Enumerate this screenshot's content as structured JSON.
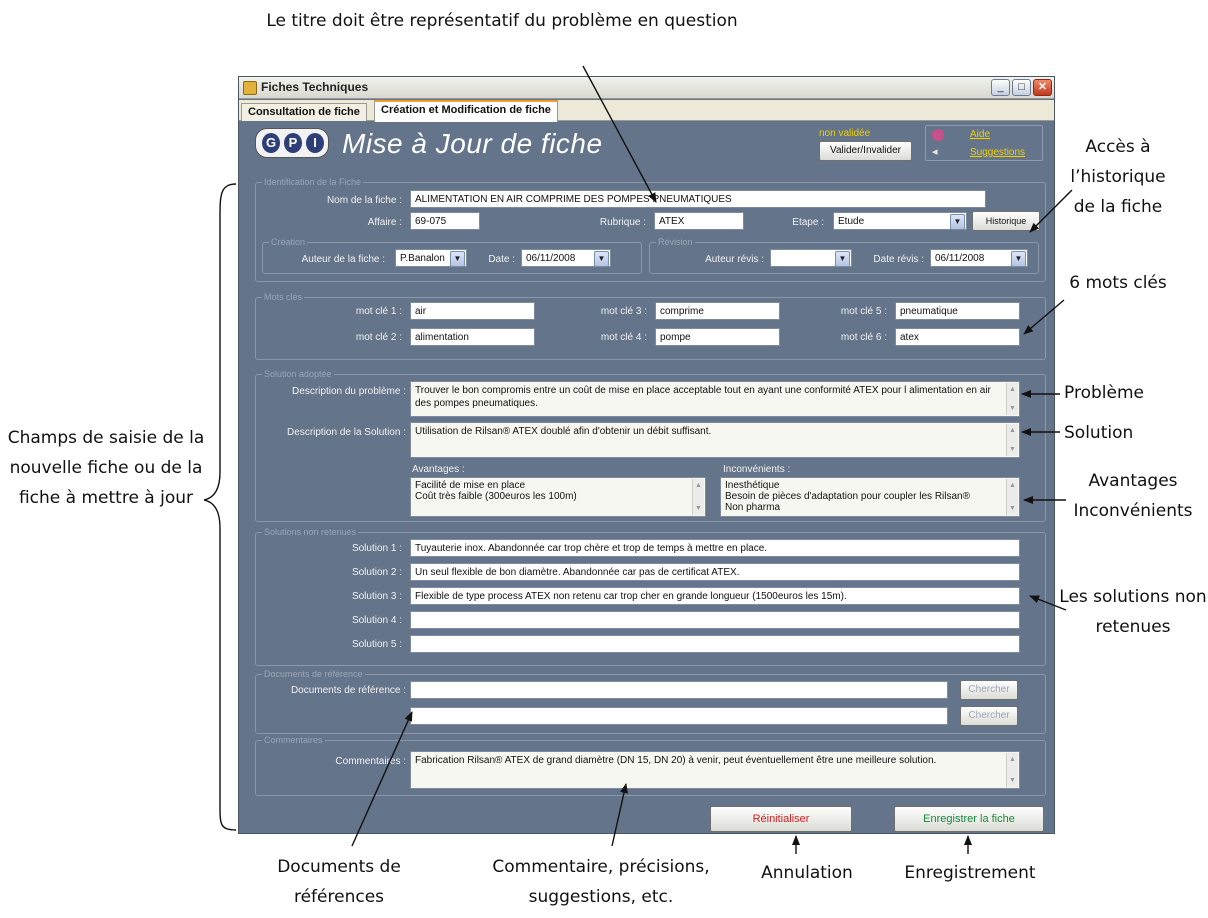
{
  "annotations": {
    "top_title": "Le titre doit être représentatif du problème en question",
    "history": "Accès à l’historique de la fiche",
    "keywords": "6 mots clés",
    "problem": "Problème",
    "solution": "Solution",
    "advantages": "Avantages Inconvénients",
    "rejected": "Les solutions non retenues",
    "left_fields": "Champs de saisie de la nouvelle fiche ou de la fiche à mettre à jour",
    "docs": "Documents de références",
    "comments": "Commentaire, précisions, suggestions, etc.",
    "cancel": "Annulation",
    "save": "Enregistrement"
  },
  "window": {
    "title": "Fiches Techniques",
    "tabs": [
      "Consultation de fiche",
      "Création et Modification de fiche"
    ],
    "active_tab": 1
  },
  "header": {
    "logo_letters": [
      "G",
      "P",
      "I"
    ],
    "title": "Mise à Jour de fiche",
    "status": "non validée",
    "validate_button": "Valider/Invalider",
    "help_link": "Aide",
    "suggestions_link": "Suggestions"
  },
  "identification": {
    "group_label": "Identification de la Fiche",
    "name_label": "Nom de la fiche :",
    "name_value": "ALIMENTATION EN AIR COMPRIME DES POMPES PNEUMATIQUES",
    "affaire_label": "Affaire :",
    "affaire_value": "69-075",
    "rubrique_label": "Rubrique :",
    "rubrique_value": "ATEX",
    "etape_label": "Etape :",
    "etape_value": "Etude",
    "history_button": "Historique",
    "creation": {
      "group_label": "Création",
      "author_label": "Auteur de la fiche :",
      "author_value": "P.Banalon",
      "date_label": "Date :",
      "date_value": "06/11/2008"
    },
    "revision": {
      "group_label": "Révision",
      "author_label": "Auteur révis :",
      "author_value": "",
      "date_label": "Date révis :",
      "date_value": "06/11/2008"
    }
  },
  "keywords": {
    "group_label": "Mots clés",
    "items": [
      {
        "label": "mot clé 1 :",
        "value": "air"
      },
      {
        "label": "mot clé 2 :",
        "value": "alimentation"
      },
      {
        "label": "mot clé 3 :",
        "value": "comprime"
      },
      {
        "label": "mot clé 4 :",
        "value": "pompe"
      },
      {
        "label": "mot clé 5 :",
        "value": "pneumatique"
      },
      {
        "label": "mot clé 6 :",
        "value": "atex"
      }
    ]
  },
  "solution": {
    "group_label": "Solution adoptée",
    "problem_label": "Description du problème :",
    "problem_value": "Trouver le bon compromis entre un coût de mise en place acceptable tout en ayant une conformité ATEX pour l alimentation en air des pompes pneumatiques.",
    "solution_label": "Description de la Solution :",
    "solution_value": "Utilisation de Rilsan® ATEX doublé afin d'obtenir un débit suffisant.",
    "advantages_label": "Avantages :",
    "advantages_lines": [
      "Facilité de mise en place",
      "Coût très faible (300euros les 100m)"
    ],
    "drawbacks_label": "Inconvénients :",
    "drawbacks_lines": [
      "Inesthétique",
      "Besoin de pièces d'adaptation pour coupler les Rilsan®",
      "Non pharma"
    ]
  },
  "rejected": {
    "group_label": "Solutions non retenues",
    "items": [
      {
        "label": "Solution 1 :",
        "value": "Tuyauterie inox. Abandonnée car trop chère et trop de temps à mettre en place."
      },
      {
        "label": "Solution 2 :",
        "value": "Un seul flexible de bon diamètre. Abandonnée car pas de certificat ATEX."
      },
      {
        "label": "Solution 3 :",
        "value": "Flexible de type process ATEX non retenu car trop cher en grande longueur (1500euros les 15m)."
      },
      {
        "label": "Solution 4 :",
        "value": ""
      },
      {
        "label": "Solution 5 :",
        "value": ""
      }
    ]
  },
  "documents": {
    "group_label": "Documents de référence",
    "label": "Documents de référence :",
    "doc1": "",
    "doc2": "",
    "browse_label": "Chercher"
  },
  "comments": {
    "group_label": "Commentaires",
    "label": "Commentaires :",
    "value": "Fabrication Rilsan® ATEX de grand diamètre (DN 15, DN 20) à venir, peut éventuellement être une meilleure solution."
  },
  "footer": {
    "reset_label": "Réinitialiser",
    "save_label": "Enregistrer la fiche"
  },
  "colors": {
    "form_bg": "#64748a",
    "status_text": "#f0d000",
    "reset_text": "#d02020",
    "save_text": "#1a8a3a"
  }
}
